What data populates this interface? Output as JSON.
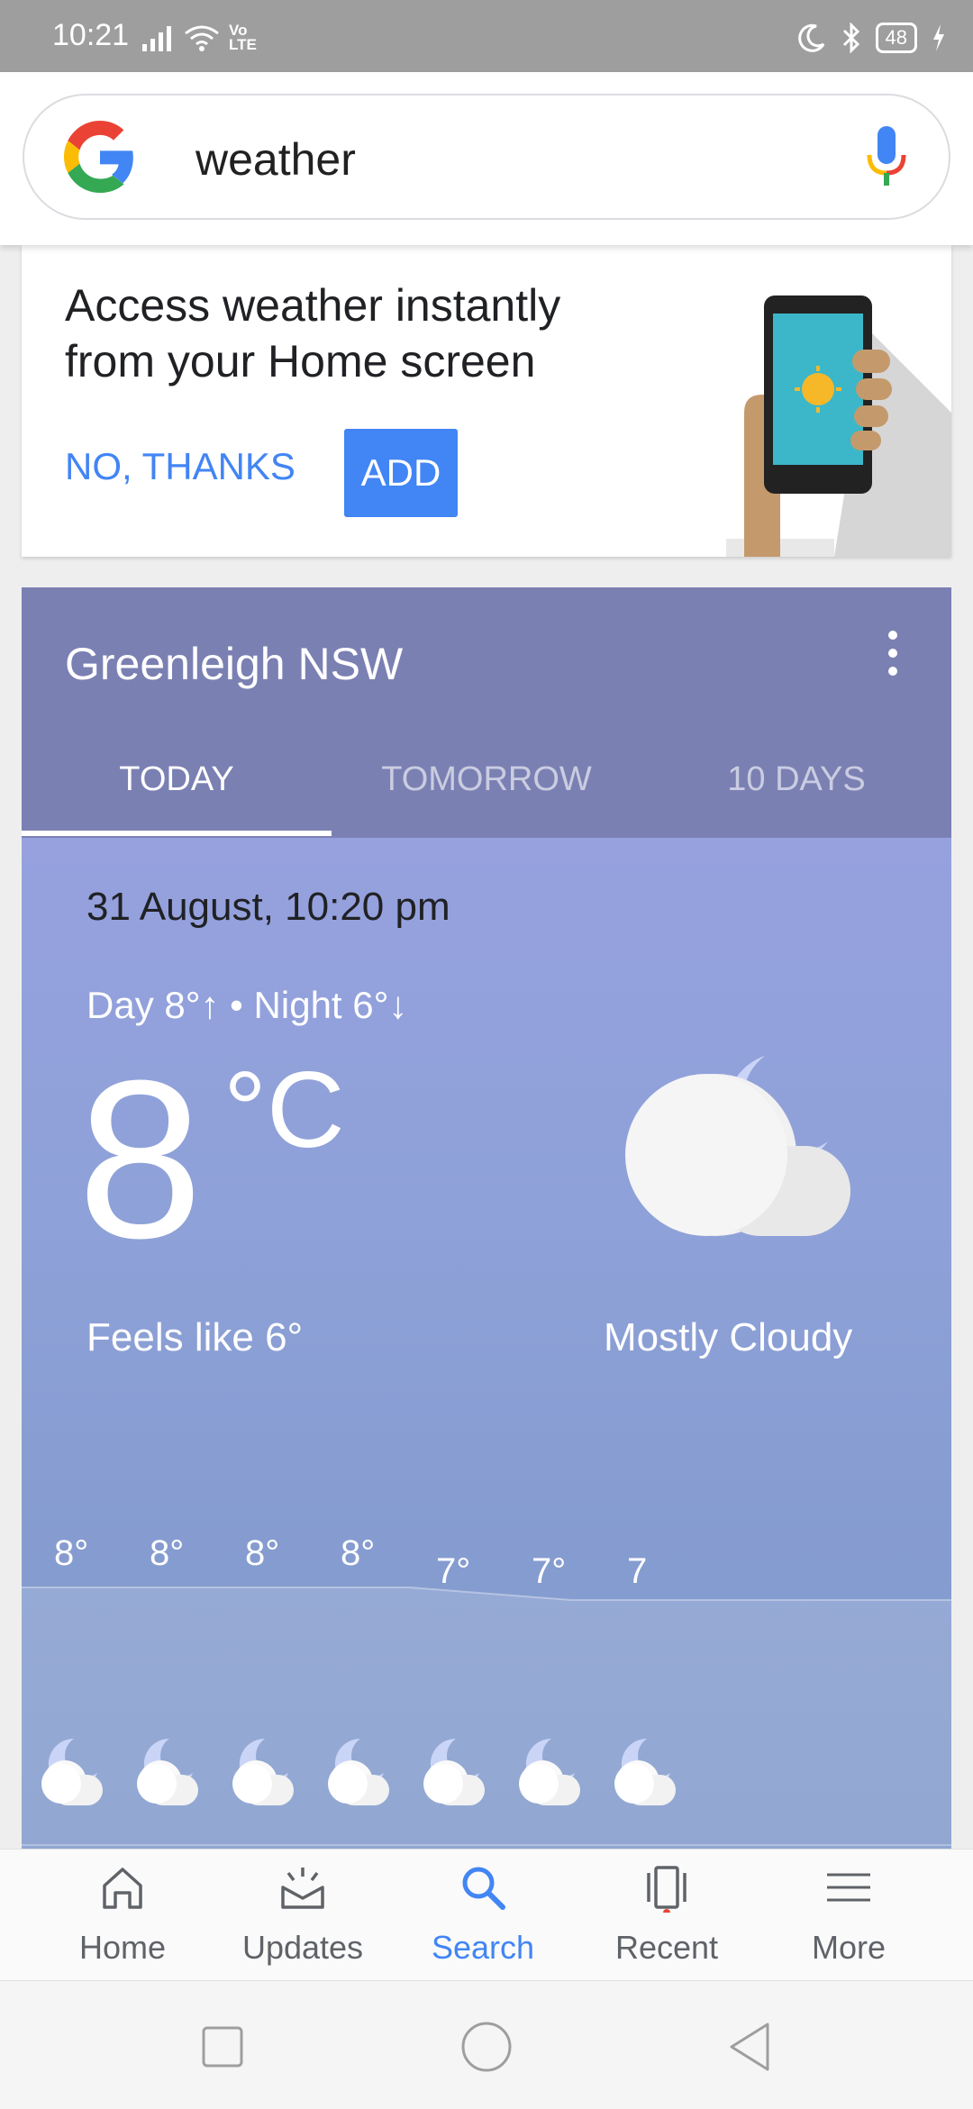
{
  "status_bar": {
    "time": "10:21",
    "network": "Vo LTE",
    "battery": "48"
  },
  "search": {
    "query": "weather"
  },
  "promo": {
    "title": "Access weather instantly from your Home screen",
    "dismiss_label": "NO, THANKS",
    "add_label": "ADD"
  },
  "weather": {
    "location": "Greenleigh NSW",
    "tabs": [
      {
        "label": "TODAY",
        "active": true
      },
      {
        "label": "TOMORROW",
        "active": false
      },
      {
        "label": "10 DAYS",
        "active": false
      }
    ],
    "datetime": "31 August, 10:20 pm",
    "day_night": "Day 8°↑ • Night 6°↓",
    "temperature": "8",
    "unit": "°C",
    "feels_like": "Feels like 6°",
    "condition": "Mostly Cloudy",
    "hourly": [
      {
        "temp": "8°",
        "icon": "night-cloud-icon"
      },
      {
        "temp": "8°",
        "icon": "night-cloud-icon"
      },
      {
        "temp": "8°",
        "icon": "night-cloud-icon"
      },
      {
        "temp": "8°",
        "icon": "night-cloud-icon"
      },
      {
        "temp": "7°",
        "icon": "night-cloud-icon"
      },
      {
        "temp": "7°",
        "icon": "night-cloud-icon"
      },
      {
        "temp": "7",
        "icon": "night-cloud-icon"
      }
    ]
  },
  "bottom_nav": [
    {
      "label": "Home",
      "icon": "home-icon",
      "active": false
    },
    {
      "label": "Updates",
      "icon": "updates-icon",
      "active": false
    },
    {
      "label": "Search",
      "icon": "search-icon",
      "active": true
    },
    {
      "label": "Recent",
      "icon": "recent-icon",
      "active": false
    },
    {
      "label": "More",
      "icon": "menu-icon",
      "active": false
    }
  ],
  "colors": {
    "accent": "#4285f4",
    "header": "#7b80b3",
    "status_bar": "#9e9e9e"
  }
}
